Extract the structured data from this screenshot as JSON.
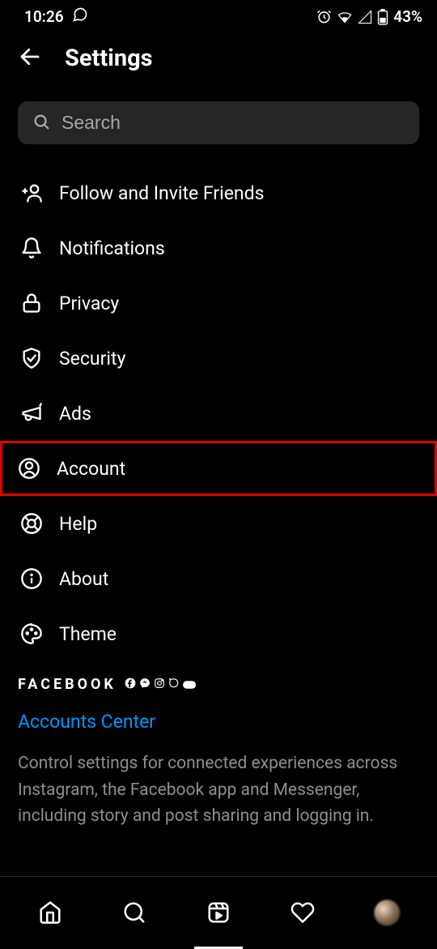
{
  "status": {
    "time": "10:26",
    "battery": "43%"
  },
  "header": {
    "title": "Settings"
  },
  "search": {
    "placeholder": "Search"
  },
  "menu": {
    "items": [
      {
        "label": "Follow and Invite Friends"
      },
      {
        "label": "Notifications"
      },
      {
        "label": "Privacy"
      },
      {
        "label": "Security"
      },
      {
        "label": "Ads"
      },
      {
        "label": "Account"
      },
      {
        "label": "Help"
      },
      {
        "label": "About"
      },
      {
        "label": "Theme"
      }
    ]
  },
  "facebook": {
    "brand": "FACEBOOK",
    "link": "Accounts Center",
    "description": "Control settings for connected experiences across Instagram, the Facebook app and Messenger, including story and post sharing and logging in."
  }
}
